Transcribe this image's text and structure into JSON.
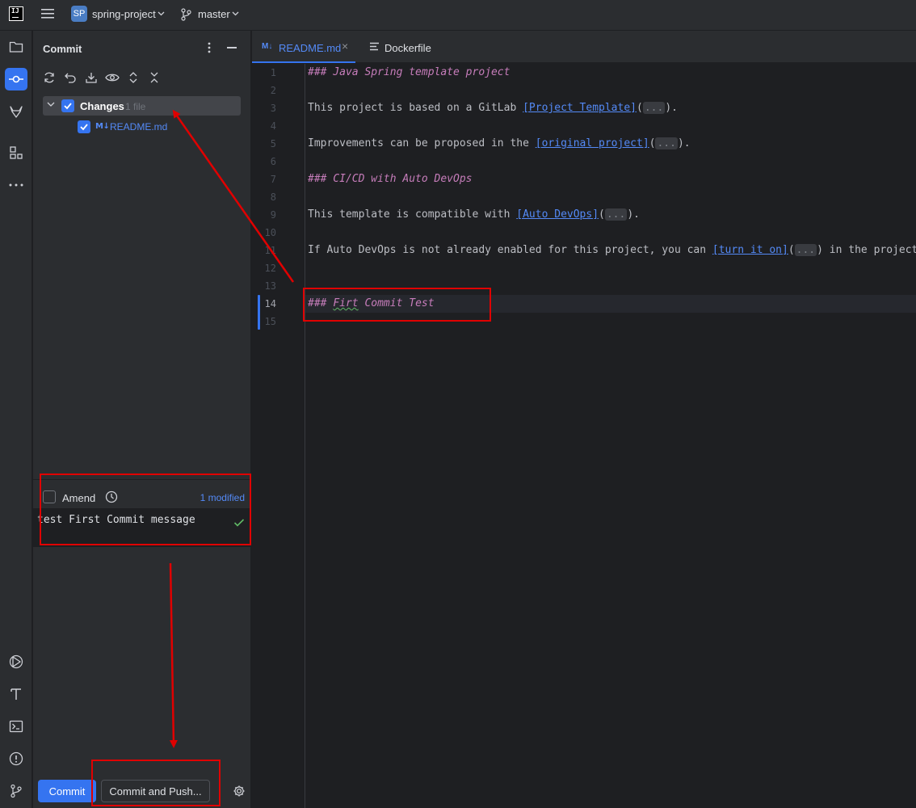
{
  "titlebar": {
    "logo_text": "IJ",
    "project_badge": "SP",
    "project_name": "spring-project",
    "branch": "master"
  },
  "commit_panel": {
    "title": "Commit",
    "changes_label": "Changes",
    "changes_count": "1 file",
    "file_icon": "M↓",
    "file_name": "README.md",
    "amend_label": "Amend",
    "modified_link": "1 modified",
    "commit_message": "test First Commit message",
    "commit_button": "Commit",
    "commit_push_button": "Commit and Push..."
  },
  "tabs": [
    {
      "icon": "M↓",
      "label": "README.md",
      "active": true
    },
    {
      "icon": "dockerfile-icon",
      "label": "Dockerfile",
      "active": false
    }
  ],
  "editor": {
    "current_line": 14,
    "lines": [
      {
        "n": "1",
        "segments": [
          {
            "t": "### Java Spring template project",
            "c": "hdr"
          }
        ]
      },
      {
        "n": "2",
        "segments": []
      },
      {
        "n": "3",
        "segments": [
          {
            "t": "This project is based on a GitLab ",
            "c": ""
          },
          {
            "t": "[Project Template]",
            "c": "lnk"
          },
          {
            "t": "(",
            "c": ""
          },
          {
            "t": "...",
            "c": "fold"
          },
          {
            "t": ").",
            "c": ""
          }
        ]
      },
      {
        "n": "4",
        "segments": []
      },
      {
        "n": "5",
        "segments": [
          {
            "t": "Improvements can be proposed in the ",
            "c": ""
          },
          {
            "t": "[original project]",
            "c": "lnk"
          },
          {
            "t": "(",
            "c": ""
          },
          {
            "t": "...",
            "c": "fold"
          },
          {
            "t": ").",
            "c": ""
          }
        ]
      },
      {
        "n": "6",
        "segments": []
      },
      {
        "n": "7",
        "segments": [
          {
            "t": "### CI/CD with Auto DevOps",
            "c": "hdr"
          }
        ]
      },
      {
        "n": "8",
        "segments": []
      },
      {
        "n": "9",
        "segments": [
          {
            "t": "This template is compatible with ",
            "c": ""
          },
          {
            "t": "[Auto DevOps]",
            "c": "lnk"
          },
          {
            "t": "(",
            "c": ""
          },
          {
            "t": "...",
            "c": "fold"
          },
          {
            "t": ").",
            "c": ""
          }
        ]
      },
      {
        "n": "10",
        "segments": []
      },
      {
        "n": "11",
        "segments": [
          {
            "t": "If Auto DevOps is not already enabled for this project, you can ",
            "c": ""
          },
          {
            "t": "[turn it on]",
            "c": "lnk"
          },
          {
            "t": "(",
            "c": ""
          },
          {
            "t": "...",
            "c": "fold"
          },
          {
            "t": ") in the project",
            "c": ""
          }
        ]
      },
      {
        "n": "12",
        "segments": []
      },
      {
        "n": "13",
        "segments": []
      },
      {
        "n": "14",
        "segments": [
          {
            "t": "### ",
            "c": "hdr"
          },
          {
            "t": "Firt",
            "c": "hdr squig"
          },
          {
            "t": " Commit Test",
            "c": "hdr"
          }
        ]
      },
      {
        "n": "15",
        "segments": []
      }
    ]
  },
  "annotation_color": "#e00000"
}
